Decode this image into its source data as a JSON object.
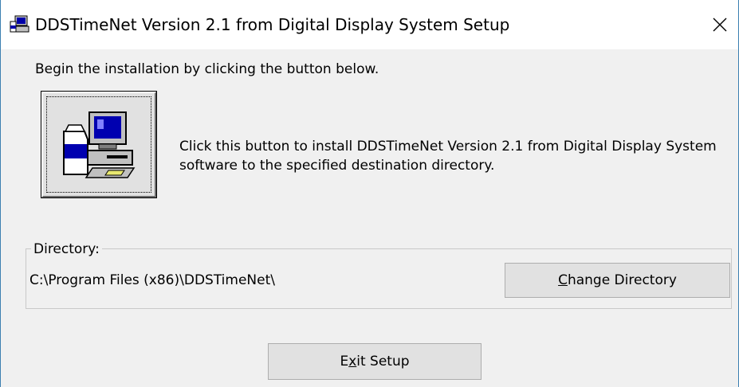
{
  "window": {
    "title": "DDSTimeNet Version 2.1 from Digital Display System Setup",
    "close_glyph": "✕"
  },
  "intro_text": "Begin the installation by clicking the button below.",
  "install": {
    "icon": "computer-setup-icon",
    "description": "Click this button to install DDSTimeNet Version 2.1 from Digital Display System software to the specified destination directory."
  },
  "directory": {
    "legend": "Directory:",
    "path": "C:\\Program Files (x86)\\DDSTimeNet\\"
  },
  "buttons": {
    "change_dir": {
      "mnemonic": "C",
      "rest": "hange Directory"
    },
    "exit": {
      "pre": "E",
      "mnemonic": "x",
      "post": "it Setup"
    }
  }
}
